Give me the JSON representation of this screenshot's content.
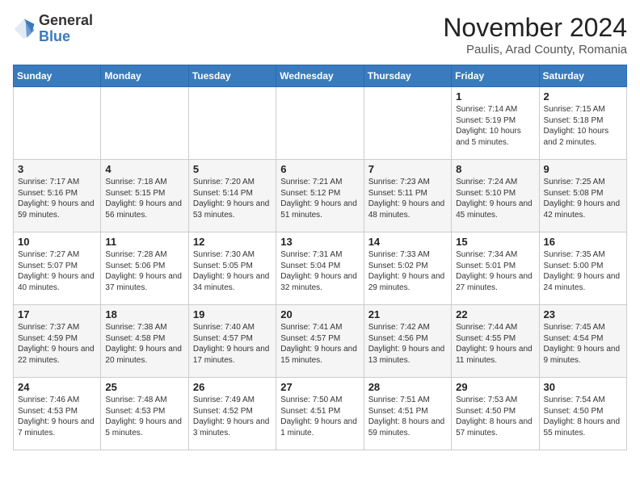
{
  "logo": {
    "general": "General",
    "blue": "Blue"
  },
  "title": {
    "month_year": "November 2024",
    "location": "Paulis, Arad County, Romania"
  },
  "weekdays": [
    "Sunday",
    "Monday",
    "Tuesday",
    "Wednesday",
    "Thursday",
    "Friday",
    "Saturday"
  ],
  "weeks": [
    [
      {
        "day": "",
        "info": ""
      },
      {
        "day": "",
        "info": ""
      },
      {
        "day": "",
        "info": ""
      },
      {
        "day": "",
        "info": ""
      },
      {
        "day": "",
        "info": ""
      },
      {
        "day": "1",
        "info": "Sunrise: 7:14 AM\nSunset: 5:19 PM\nDaylight: 10 hours and 5 minutes."
      },
      {
        "day": "2",
        "info": "Sunrise: 7:15 AM\nSunset: 5:18 PM\nDaylight: 10 hours and 2 minutes."
      }
    ],
    [
      {
        "day": "3",
        "info": "Sunrise: 7:17 AM\nSunset: 5:16 PM\nDaylight: 9 hours and 59 minutes."
      },
      {
        "day": "4",
        "info": "Sunrise: 7:18 AM\nSunset: 5:15 PM\nDaylight: 9 hours and 56 minutes."
      },
      {
        "day": "5",
        "info": "Sunrise: 7:20 AM\nSunset: 5:14 PM\nDaylight: 9 hours and 53 minutes."
      },
      {
        "day": "6",
        "info": "Sunrise: 7:21 AM\nSunset: 5:12 PM\nDaylight: 9 hours and 51 minutes."
      },
      {
        "day": "7",
        "info": "Sunrise: 7:23 AM\nSunset: 5:11 PM\nDaylight: 9 hours and 48 minutes."
      },
      {
        "day": "8",
        "info": "Sunrise: 7:24 AM\nSunset: 5:10 PM\nDaylight: 9 hours and 45 minutes."
      },
      {
        "day": "9",
        "info": "Sunrise: 7:25 AM\nSunset: 5:08 PM\nDaylight: 9 hours and 42 minutes."
      }
    ],
    [
      {
        "day": "10",
        "info": "Sunrise: 7:27 AM\nSunset: 5:07 PM\nDaylight: 9 hours and 40 minutes."
      },
      {
        "day": "11",
        "info": "Sunrise: 7:28 AM\nSunset: 5:06 PM\nDaylight: 9 hours and 37 minutes."
      },
      {
        "day": "12",
        "info": "Sunrise: 7:30 AM\nSunset: 5:05 PM\nDaylight: 9 hours and 34 minutes."
      },
      {
        "day": "13",
        "info": "Sunrise: 7:31 AM\nSunset: 5:04 PM\nDaylight: 9 hours and 32 minutes."
      },
      {
        "day": "14",
        "info": "Sunrise: 7:33 AM\nSunset: 5:02 PM\nDaylight: 9 hours and 29 minutes."
      },
      {
        "day": "15",
        "info": "Sunrise: 7:34 AM\nSunset: 5:01 PM\nDaylight: 9 hours and 27 minutes."
      },
      {
        "day": "16",
        "info": "Sunrise: 7:35 AM\nSunset: 5:00 PM\nDaylight: 9 hours and 24 minutes."
      }
    ],
    [
      {
        "day": "17",
        "info": "Sunrise: 7:37 AM\nSunset: 4:59 PM\nDaylight: 9 hours and 22 minutes."
      },
      {
        "day": "18",
        "info": "Sunrise: 7:38 AM\nSunset: 4:58 PM\nDaylight: 9 hours and 20 minutes."
      },
      {
        "day": "19",
        "info": "Sunrise: 7:40 AM\nSunset: 4:57 PM\nDaylight: 9 hours and 17 minutes."
      },
      {
        "day": "20",
        "info": "Sunrise: 7:41 AM\nSunset: 4:57 PM\nDaylight: 9 hours and 15 minutes."
      },
      {
        "day": "21",
        "info": "Sunrise: 7:42 AM\nSunset: 4:56 PM\nDaylight: 9 hours and 13 minutes."
      },
      {
        "day": "22",
        "info": "Sunrise: 7:44 AM\nSunset: 4:55 PM\nDaylight: 9 hours and 11 minutes."
      },
      {
        "day": "23",
        "info": "Sunrise: 7:45 AM\nSunset: 4:54 PM\nDaylight: 9 hours and 9 minutes."
      }
    ],
    [
      {
        "day": "24",
        "info": "Sunrise: 7:46 AM\nSunset: 4:53 PM\nDaylight: 9 hours and 7 minutes."
      },
      {
        "day": "25",
        "info": "Sunrise: 7:48 AM\nSunset: 4:53 PM\nDaylight: 9 hours and 5 minutes."
      },
      {
        "day": "26",
        "info": "Sunrise: 7:49 AM\nSunset: 4:52 PM\nDaylight: 9 hours and 3 minutes."
      },
      {
        "day": "27",
        "info": "Sunrise: 7:50 AM\nSunset: 4:51 PM\nDaylight: 9 hours and 1 minute."
      },
      {
        "day": "28",
        "info": "Sunrise: 7:51 AM\nSunset: 4:51 PM\nDaylight: 8 hours and 59 minutes."
      },
      {
        "day": "29",
        "info": "Sunrise: 7:53 AM\nSunset: 4:50 PM\nDaylight: 8 hours and 57 minutes."
      },
      {
        "day": "30",
        "info": "Sunrise: 7:54 AM\nSunset: 4:50 PM\nDaylight: 8 hours and 55 minutes."
      }
    ]
  ]
}
